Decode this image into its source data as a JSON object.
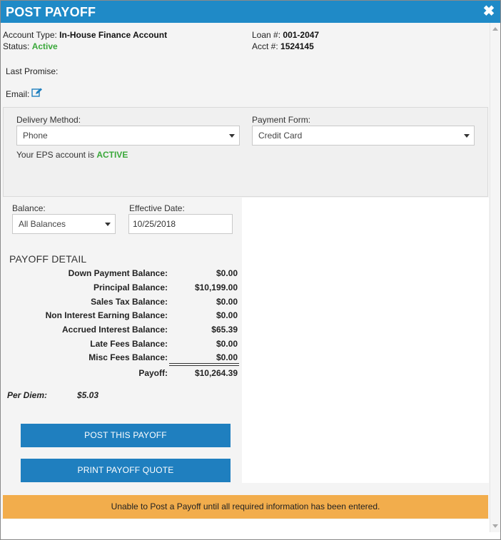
{
  "window": {
    "title": "POST PAYOFF",
    "close_symbol": "✖"
  },
  "account": {
    "type_label": "Account Type:",
    "type_value": "In-House Finance Account",
    "status_label": "Status:",
    "status_value": "Active",
    "loan_label": "Loan #:",
    "loan_value": "001-2047",
    "acct_label": "Acct #:",
    "acct_value": "1524145",
    "last_promise_label": "Last Promise:",
    "email_label": "Email:"
  },
  "delivery": {
    "delivery_method_label": "Delivery Method:",
    "delivery_method_value": "Phone",
    "payment_form_label": "Payment Form:",
    "payment_form_value": "Credit Card",
    "eps_text": "Your EPS account is",
    "eps_status": "ACTIVE"
  },
  "payoff": {
    "balance_label": "Balance:",
    "balance_value": "All Balances",
    "effective_date_label": "Effective Date:",
    "effective_date_value": "10/25/2018",
    "detail_title": "PAYOFF DETAIL",
    "rows": [
      {
        "label": "Down Payment Balance:",
        "value": "$0.00"
      },
      {
        "label": "Principal Balance:",
        "value": "$10,199.00"
      },
      {
        "label": "Sales Tax Balance:",
        "value": "$0.00"
      },
      {
        "label": "Non Interest Earning Balance:",
        "value": "$0.00"
      },
      {
        "label": "Accrued Interest Balance:",
        "value": "$65.39"
      },
      {
        "label": "Late Fees Balance:",
        "value": "$0.00"
      },
      {
        "label": "Misc Fees Balance:",
        "value": "$0.00"
      }
    ],
    "total_label": "Payoff:",
    "total_value": "$10,264.39",
    "per_diem_label": "Per Diem:",
    "per_diem_value": "$5.03"
  },
  "actions": {
    "post_label": "POST THIS PAYOFF",
    "print_label": "PRINT PAYOFF QUOTE"
  },
  "warning": {
    "text": "Unable to Post a Payoff until all required information has been entered."
  },
  "colors": {
    "header": "#1f8ac7",
    "button": "#1f7fbf",
    "active_green": "#3aa83a",
    "warning_bg": "#f2ad4c"
  }
}
